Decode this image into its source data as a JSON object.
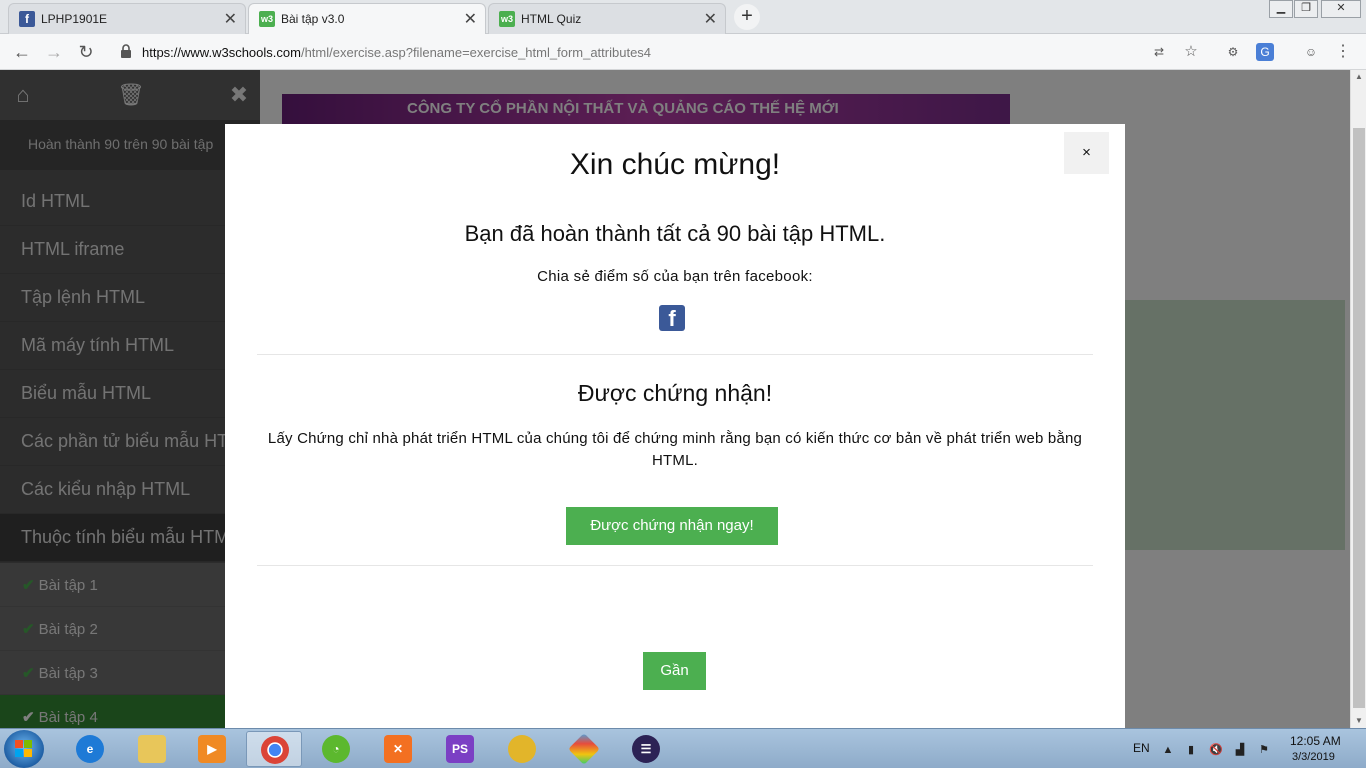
{
  "browser": {
    "tabs": [
      {
        "title": "LPHP1901E",
        "icon": "facebook-icon"
      },
      {
        "title": "Bài tập v3.0",
        "icon": "w3schools-icon"
      },
      {
        "title": "HTML Quiz",
        "icon": "w3schools-icon"
      }
    ],
    "url_host": "https://www.w3schools.com",
    "url_path": "/html/exercise.asp?filename=exercise_html_form_attributes4"
  },
  "sidebar": {
    "progress": "Hoàn thành 90 trên 90 bài tập",
    "menu": [
      "Id HTML",
      "HTML iframe",
      "Tập lệnh HTML",
      "Mã máy tính HTML",
      "Biểu mẫu HTML",
      "Các phần tử biểu mẫu HTML",
      "Các kiểu nhập HTML",
      "Thuộc tính biểu mẫu HTML"
    ],
    "exercises": [
      "Bài tập 1",
      "Bài tập 2",
      "Bài tập 3",
      "Bài tập 4"
    ]
  },
  "ad": {
    "text": "CÔNG TY CỔ PHẦN NỘI THẤT VÀ QUẢNG CÁO THẾ HỆ MỚI"
  },
  "modal": {
    "close_symbol": "×",
    "title": "Xin chúc mừng!",
    "done_message": "Bạn đã hoàn thành tất cả 90 bài tập HTML.",
    "share_message": "Chia sẻ điểm số của bạn trên facebook:",
    "cert_title": "Được chứng nhận!",
    "cert_description": "Lấy Chứng chỉ nhà phát triển HTML của chúng tôi để chứng minh rằng bạn có kiến thức cơ bản về phát triển web bằng HTML.",
    "cert_button": "Được chứng nhận ngay!",
    "close_button": "Gần"
  },
  "taskbar": {
    "language": "EN",
    "time": "12:05 AM",
    "date": "3/3/2019"
  },
  "colors": {
    "accent_green": "#4caf50",
    "facebook_blue": "#3b5998"
  }
}
